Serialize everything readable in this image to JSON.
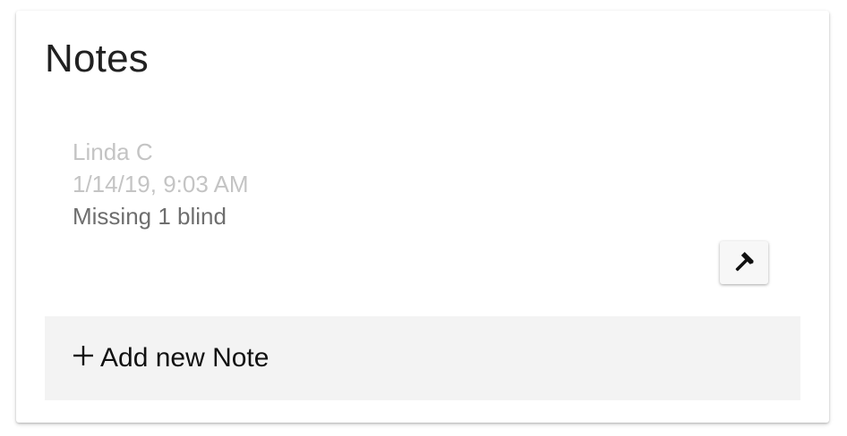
{
  "card": {
    "title": "Notes"
  },
  "note": {
    "author": "Linda C",
    "date": "1/14/19, 9:03 AM",
    "text": "Missing 1 blind",
    "edit_icon": "hammer-icon"
  },
  "add_note": {
    "icon": "plus-icon",
    "label": "Add new Note"
  },
  "colors": {
    "meta_text": "#c4c4c4",
    "body_text": "#6e6e6e",
    "add_note_bg": "#f3f3f3"
  }
}
